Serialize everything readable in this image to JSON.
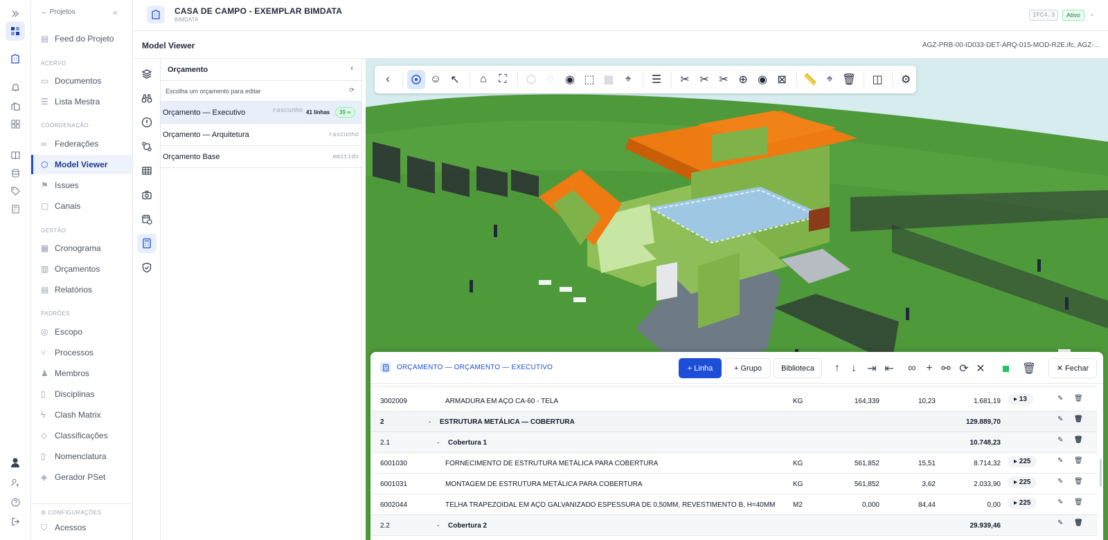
{
  "nav": {
    "back_label": "← Projetos",
    "sections": {
      "acervo": "ACERVO",
      "coordenacao": "COORDENAÇÃO",
      "gestao": "GESTÃO",
      "padroes": "PADRÕES",
      "config": "CONFIGURAÇÕES"
    },
    "items": {
      "feed": "Feed do Projeto",
      "documentos": "Documentos",
      "lista_mestra": "Lista Mestra",
      "federacoes": "Federações",
      "model_viewer": "Model Viewer",
      "issues": "Issues",
      "canais": "Canais",
      "cronograma": "Cronograma",
      "orcamentos": "Orçamentos",
      "relatorios": "Relatórios",
      "escopo": "Escopo",
      "processos": "Processos",
      "membros": "Membros",
      "disciplinas": "Disciplinas",
      "clash_matrix": "Clash Matrix",
      "classificacoes": "Classificações",
      "nomenclatura": "Nomenclatura",
      "gerador_pset": "Gerador PSet",
      "acessos": "Acessos"
    }
  },
  "header": {
    "title": "CASA DE CAMPO - EXEMPLAR BIMDATA",
    "subtitle": "BIMDATA",
    "schema_badge": "IFC4.3",
    "status_badge": "Ativo"
  },
  "viewer_bar": {
    "title": "Model Viewer",
    "files": "AGZ-PRB-00-ID033-DET-ARQ-015-MOD-R2E.ifc, AGZ-..."
  },
  "budget_panel": {
    "title": "Orçamento",
    "search_placeholder": "Escolha um orçamento para editar",
    "items": [
      {
        "name": "Orçamento — Executivo",
        "status": "rascunho",
        "lines": "41 linhas",
        "badge": "39 ∞"
      },
      {
        "name": "Orçamento — Arquitetura",
        "status": "rascunho"
      },
      {
        "name": "Orçamento Base",
        "status": "emitido"
      }
    ]
  },
  "budget_table": {
    "title": "ORÇAMENTO — ORÇAMENTO — EXECUTIVO",
    "add_line": "+ Linha",
    "add_group": "+ Grupo",
    "library": "Biblioteca",
    "close": "✕ Fechar",
    "rows": [
      {
        "code": "3002009",
        "desc": "ARMADURA EM AÇO CA-60 - TELA",
        "unit": "KG",
        "qty": "164,339",
        "price": "10,23",
        "total": "1.681,19",
        "links": "▸ 13"
      },
      {
        "code": "2",
        "desc": "ESTRUTURA METÁLICA — COBERTURA",
        "total": "129.889,70"
      },
      {
        "code": "2.1",
        "desc": "Cobertura 1",
        "total": "10.748,23"
      },
      {
        "code": "6001030",
        "desc": "FORNECIMENTO DE ESTRUTURA METÁLICA PARA COBERTURA",
        "unit": "KG",
        "qty": "561,852",
        "price": "15,51",
        "total": "8.714,32",
        "links": "▸ 225"
      },
      {
        "code": "6001031",
        "desc": "MONTAGEM DE ESTRUTURA METÁLICA PARA COBERTURA",
        "unit": "KG",
        "qty": "561,852",
        "price": "3,62",
        "total": "2.033,90",
        "links": "▸ 225"
      },
      {
        "code": "6002044",
        "desc": "TELHA TRAPEZOIDAL EM AÇO GALVANIZADO ESPESSURA DE 0,50MM, REVESTIMENTO B, H=40MM",
        "unit": "M2",
        "qty": "0,000",
        "price": "84,44",
        "total": "0,00",
        "links": "▸ 225"
      },
      {
        "code": "2.2",
        "desc": "Cobertura 2",
        "total": "29.939,46"
      }
    ]
  },
  "colors": {
    "accent": "#1d4ed8",
    "roof": "#e8730c",
    "walls": "#7fb34a",
    "terrain": "#4e9a3a"
  }
}
